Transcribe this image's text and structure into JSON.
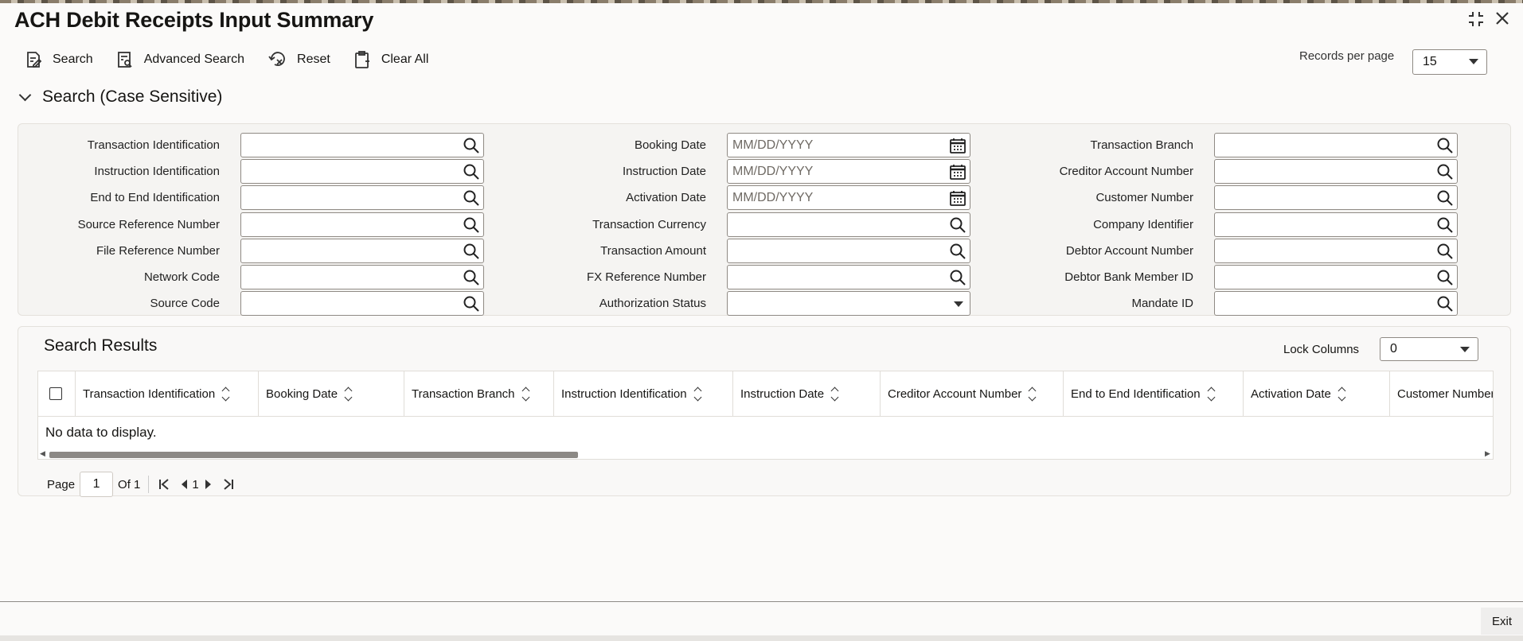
{
  "window": {
    "title": "ACH Debit Receipts Input Summary"
  },
  "toolbar": {
    "search": "Search",
    "advanced_search": "Advanced Search",
    "reset": "Reset",
    "clear_all": "Clear All",
    "records_per_page_label": "Records per page",
    "records_per_page_value": "15"
  },
  "search_section": {
    "title": "Search (Case Sensitive)",
    "date_placeholder": "MM/DD/YYYY",
    "col1": [
      "Transaction Identification",
      "Instruction Identification",
      "End to End Identification",
      "Source Reference Number",
      "File Reference Number",
      "Network Code",
      "Source Code"
    ],
    "col2": [
      "Booking Date",
      "Instruction Date",
      "Activation Date",
      "Transaction Currency",
      "Transaction Amount",
      "FX Reference Number",
      "Authorization Status"
    ],
    "col3": [
      "Transaction Branch",
      "Creditor Account Number",
      "Customer Number",
      "Company Identifier",
      "Debtor Account Number",
      "Debtor Bank Member ID",
      "Mandate ID"
    ]
  },
  "results": {
    "title": "Search Results",
    "lock_columns_label": "Lock Columns",
    "lock_columns_value": "0",
    "columns": [
      "Transaction Identification",
      "Booking Date",
      "Transaction Branch",
      "Instruction Identification",
      "Instruction Date",
      "Creditor Account Number",
      "End to End Identification",
      "Activation Date",
      "Customer Number"
    ],
    "empty_message": "No data to display."
  },
  "pagination": {
    "page_label": "Page",
    "page_value": "1",
    "of_label": "Of 1",
    "current": "1"
  },
  "footer": {
    "exit": "Exit"
  }
}
